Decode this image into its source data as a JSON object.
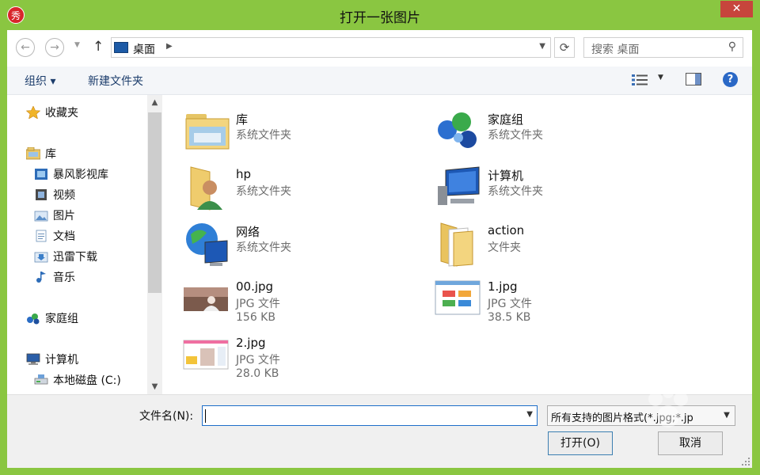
{
  "window": {
    "title": "打开一张图片",
    "close_glyph": "✕",
    "app_icon_glyph": "秀"
  },
  "nav": {
    "address": "桌面",
    "search_placeholder": "搜索 桌面"
  },
  "toolbar": {
    "organize": "组织 ▾",
    "new_folder": "新建文件夹"
  },
  "sidebar": {
    "items": [
      {
        "label": "收藏夹",
        "icon": "star-icon"
      },
      {
        "label": "库",
        "icon": "library-icon"
      },
      {
        "label": "暴风影视库",
        "icon": "video-library-icon"
      },
      {
        "label": "视频",
        "icon": "videos-icon"
      },
      {
        "label": "图片",
        "icon": "pictures-icon"
      },
      {
        "label": "文档",
        "icon": "documents-icon"
      },
      {
        "label": "迅雷下载",
        "icon": "download-icon"
      },
      {
        "label": "音乐",
        "icon": "music-icon"
      },
      {
        "label": "家庭组",
        "icon": "homegroup-icon"
      },
      {
        "label": "计算机",
        "icon": "computer-icon"
      },
      {
        "label": "本地磁盘 (C:)",
        "icon": "drive-icon"
      }
    ]
  },
  "files": [
    {
      "name": "库",
      "type": "系统文件夹",
      "size": "",
      "icon": "library-icon"
    },
    {
      "name": "家庭组",
      "type": "系统文件夹",
      "size": "",
      "icon": "homegroup-icon"
    },
    {
      "name": "hp",
      "type": "系统文件夹",
      "size": "",
      "icon": "user-folder-icon"
    },
    {
      "name": "计算机",
      "type": "系统文件夹",
      "size": "",
      "icon": "computer-icon"
    },
    {
      "name": "网络",
      "type": "系统文件夹",
      "size": "",
      "icon": "network-icon"
    },
    {
      "name": "action",
      "type": "文件夹",
      "size": "",
      "icon": "folder-icon"
    },
    {
      "name": "00.jpg",
      "type": "JPG 文件",
      "size": "156 KB",
      "icon": "image-thumbnail-icon"
    },
    {
      "name": "1.jpg",
      "type": "JPG 文件",
      "size": "38.5 KB",
      "icon": "image-thumbnail-icon"
    },
    {
      "name": "2.jpg",
      "type": "JPG 文件",
      "size": "28.0 KB",
      "icon": "image-thumbnail-icon"
    }
  ],
  "footer": {
    "filename_label": "文件名(N):",
    "filename_value": "",
    "filetype": "所有支持的图片格式(*.jpg;*.jp",
    "open_button": "打开(O)",
    "cancel_button": "取消"
  },
  "colors": {
    "frame": "#8ac641",
    "close": "#c7453c",
    "accent": "#1e6ec9"
  }
}
